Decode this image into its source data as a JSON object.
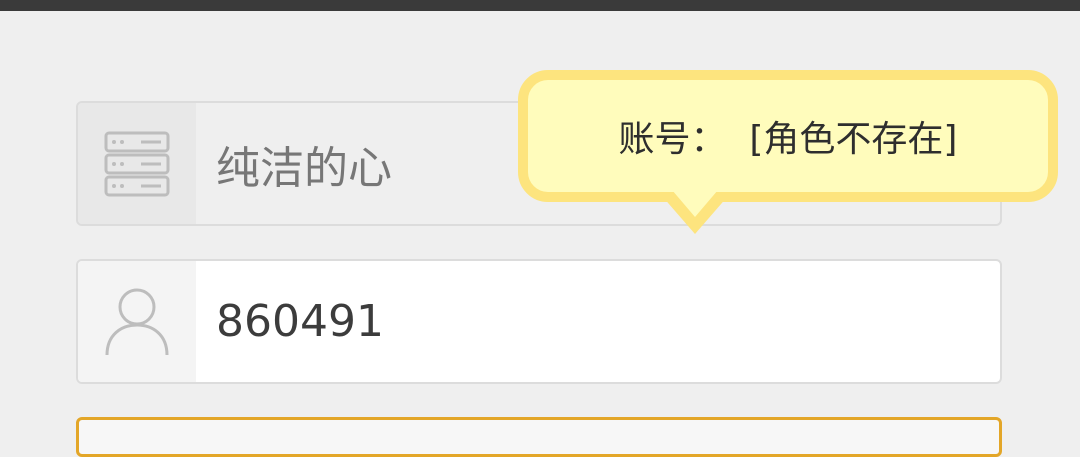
{
  "server_field": {
    "icon": "server-icon",
    "value": "纯洁的心"
  },
  "account_field": {
    "icon": "user-icon",
    "value": "860491"
  },
  "tooltip": {
    "message": "账号：  [角色不存在]"
  },
  "colors": {
    "tooltip_fill": "#fffcbc",
    "tooltip_border": "#fde47e",
    "focus_border": "#e3a628"
  }
}
